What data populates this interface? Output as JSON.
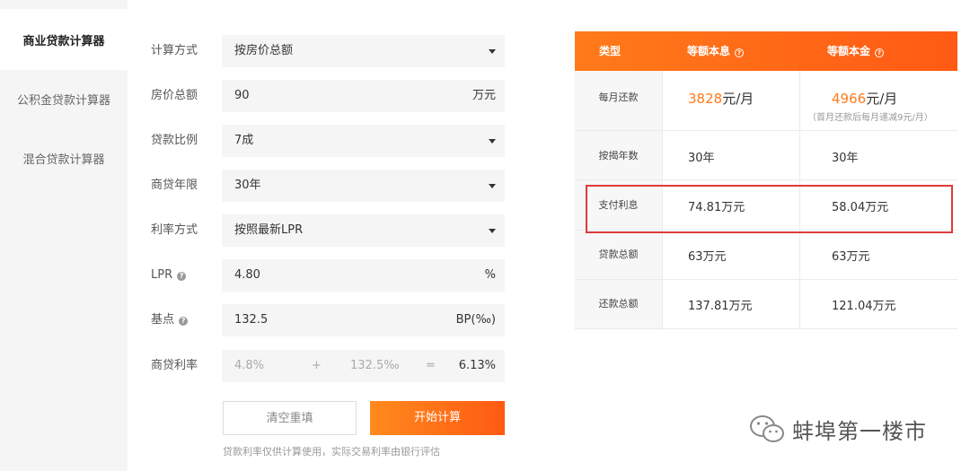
{
  "sidebar": {
    "items": [
      {
        "label": "商业贷款计算器",
        "active": true
      },
      {
        "label": "公积金贷款计算器",
        "active": false
      },
      {
        "label": "混合贷款计算器",
        "active": false
      }
    ]
  },
  "form": {
    "calc_method": {
      "label": "计算方式",
      "value": "按房价总额"
    },
    "total_price": {
      "label": "房价总额",
      "value": "90",
      "unit": "万元"
    },
    "loan_ratio": {
      "label": "贷款比例",
      "value": "7成"
    },
    "loan_years": {
      "label": "商贷年限",
      "value": "30年"
    },
    "rate_method": {
      "label": "利率方式",
      "value": "按照最新LPR"
    },
    "lpr": {
      "label": "LPR",
      "value": "4.80",
      "unit": "%"
    },
    "basis": {
      "label": "基点",
      "value": "132.5",
      "unit": "BP(‰)"
    },
    "rate": {
      "label": "商贷利率",
      "lpr": "4.8%",
      "plus": "+",
      "bp": "132.5‰",
      "eq": "=",
      "result": "6.13%"
    },
    "clear_label": "清空重填",
    "start_label": "开始计算",
    "note": "贷款利率仅供计算使用，实际交易利率由银行评估"
  },
  "results": {
    "headers": {
      "type": "类型",
      "equal_installment": "等额本息",
      "equal_principal": "等额本金"
    },
    "monthly": {
      "label": "每月还款",
      "ei_amount": "3828",
      "ei_unit": "元/月",
      "ep_amount": "4966",
      "ep_unit": "元/月",
      "ep_note": "（首月还款后每月递减9元/月）"
    },
    "years": {
      "label": "按揭年数",
      "ei": "30年",
      "ep": "30年"
    },
    "interest": {
      "label": "支付利息",
      "ei": "74.81万元",
      "ep": "58.04万元"
    },
    "loan_total": {
      "label": "贷款总额",
      "ei": "63万元",
      "ep": "63万元"
    },
    "repay_total": {
      "label": "还款总额",
      "ei": "137.81万元",
      "ep": "121.04万元"
    }
  },
  "watermark": {
    "text": "蚌埠第一楼市",
    "icon": "wechat-icon"
  },
  "colors": {
    "accent": "#ff6a14",
    "highlight": "#e03a3a"
  }
}
